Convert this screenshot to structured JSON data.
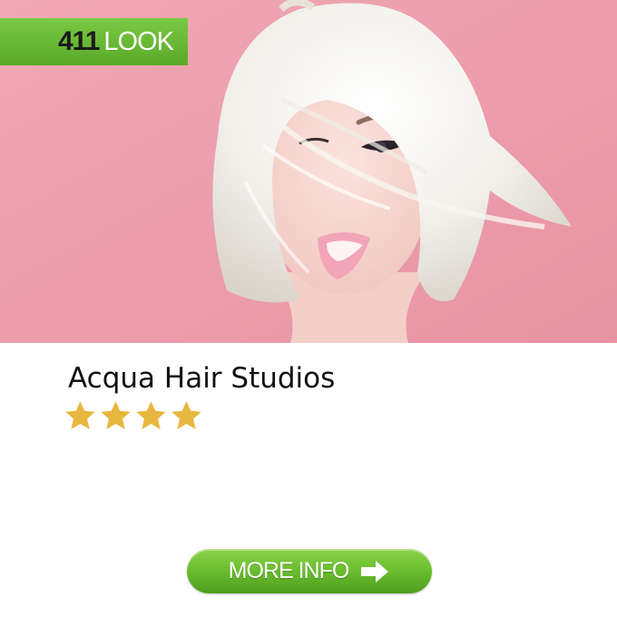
{
  "brand": {
    "number": "411",
    "word": "LOOK",
    "badge_color": "#6cbf35"
  },
  "listing": {
    "title": "Acqua Hair Studios",
    "rating": 4,
    "rating_max": 4,
    "star_color": "#e8b73f"
  },
  "hero": {
    "icon": "hero-photo",
    "background_color": "#eea2ae"
  },
  "cta": {
    "label": "MORE INFO",
    "icon": "arrow-right-icon",
    "color": "#6cbf30"
  }
}
